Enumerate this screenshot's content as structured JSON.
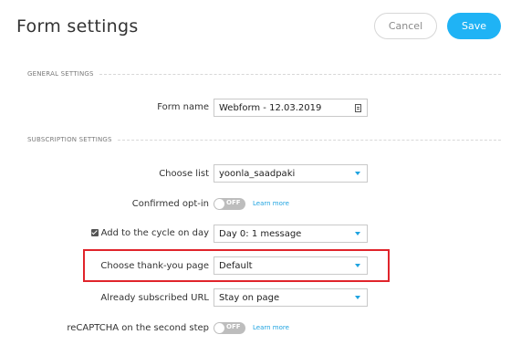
{
  "header": {
    "title": "Form settings",
    "cancel_label": "Cancel",
    "save_label": "Save"
  },
  "sections": {
    "general": "GENERAL SETTINGS",
    "subscription": "SUBSCRIPTION SETTINGS"
  },
  "form_name": {
    "label": "Form name",
    "value": "Webform - 12.03.2019",
    "icon": "calendar-icon"
  },
  "choose_list": {
    "label": "Choose list",
    "value": "yoonla_saadpaki"
  },
  "confirmed_optin": {
    "label": "Confirmed opt-in",
    "toggle_text": "OFF",
    "learn_more": "Learn more"
  },
  "cycle": {
    "label": "Add to the cycle on day",
    "checked": true,
    "value": "Day 0: 1 message"
  },
  "thank_you": {
    "label": "Choose thank-you page",
    "value": "Default"
  },
  "already_subscribed": {
    "label": "Already subscribed URL",
    "value": "Stay on page"
  },
  "recaptcha": {
    "label": "reCAPTCHA on the second step",
    "toggle_text": "OFF",
    "learn_more": "Learn more"
  },
  "colors": {
    "accent": "#1fb3f5",
    "highlight": "#e0242b"
  }
}
